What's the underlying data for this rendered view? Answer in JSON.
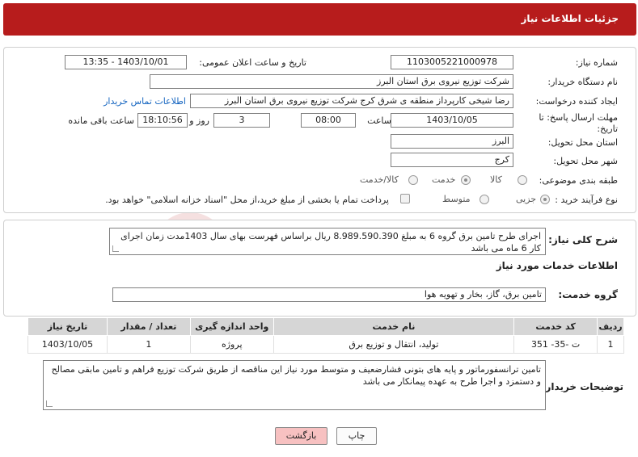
{
  "header": {
    "title": "جزئیات اطلاعات نیاز"
  },
  "watermark": {
    "text": "AriaTender.neT"
  },
  "form": {
    "need_number": {
      "label": "شماره نیاز:",
      "value": "1103005221000978"
    },
    "announce_datetime": {
      "label": "تاریخ و ساعت اعلان عمومی:",
      "value": "1403/10/01 - 13:35"
    },
    "buyer_org": {
      "label": "نام دستگاه خریدار:",
      "value": "شرکت توزیع نیروی برق استان البرز"
    },
    "requester": {
      "label": "ایجاد کننده درخواست:",
      "value": "رضا شیخی کارپرداز منطقه ی شرق کرج شرکت توزیع نیروی برق استان البرز",
      "contact_link": "اطلاعات تماس خریدار"
    },
    "deadline": {
      "label_line1": "مهلت ارسال پاسخ: تا",
      "label_line2": "تاریخ:",
      "date": "1403/10/05",
      "time_label": "ساعت",
      "time": "08:00",
      "days": "3",
      "days_label": "روز و",
      "remaining": "18:10:56",
      "remaining_label": "ساعت باقی مانده"
    },
    "province": {
      "label": "استان محل تحویل:",
      "value": "البرز"
    },
    "city": {
      "label": "شهر محل تحویل:",
      "value": "کرج"
    },
    "category": {
      "label": "طبقه بندی موضوعی:",
      "options": [
        "کالا",
        "خدمت",
        "کالا/خدمت"
      ],
      "selected": "خدمت"
    },
    "purchase_type": {
      "label": "نوع فرآیند خرید :",
      "options": [
        "جزیی",
        "متوسط"
      ],
      "selected": "جزیی",
      "note": "پرداخت تمام یا بخشی از مبلغ خرید،از محل \"اسناد خزانه اسلامی\" خواهد بود."
    }
  },
  "summary": {
    "label": "شرح کلی نیاز:",
    "text": "اجرای طرح تامین برق گروه 6 به مبلغ 8.989.590.390 ریال براساس فهرست بهای سال 1403مدت زمان اجرای کار 6 ماه می باشد"
  },
  "services": {
    "section_title": "اطلاعات خدمات مورد نیاز",
    "group_label": "گروه خدمت:",
    "group_value": "تامین برق، گاز، بخار و تهویه هوا",
    "table": {
      "headers": [
        "ردیف",
        "کد خدمت",
        "نام خدمت",
        "واحد اندازه گیری",
        "تعداد / مقدار",
        "تاریخ نیاز"
      ],
      "rows": [
        [
          "1",
          "ت -35- 351",
          "تولید، انتقال و توزیع برق",
          "پروژه",
          "1",
          "1403/10/05"
        ]
      ]
    }
  },
  "buyer_notes": {
    "label": "توضیحات خریدار:",
    "text": "تامین ترانسفورماتور و پایه های بتونی فشارضعیف و متوسط مورد نیاز این مناقصه از طریق شرکت توزیع فراهم و تامین مابقی مصالح و دستمزد و اجرا طرح به عهده پیمانکار می باشد"
  },
  "buttons": {
    "print": "چاپ",
    "back": "بازگشت"
  },
  "colors": {
    "header": "#b71c1c",
    "back_button": "#f7c1c1",
    "link": "#1565c0"
  }
}
